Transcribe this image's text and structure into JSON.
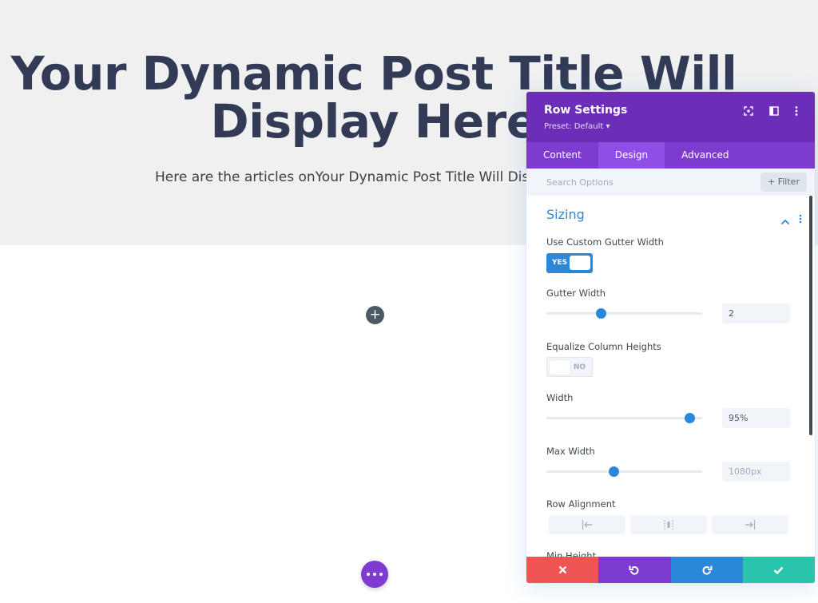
{
  "hero": {
    "title": "Your Dynamic Post Title Will Display Here",
    "subtitle": "Here are the articles onYour Dynamic Post Title Will Dis"
  },
  "canvas": {
    "add_icon": "+"
  },
  "panel": {
    "title": "Row Settings",
    "preset": "Preset: Default ▾",
    "tabs": [
      {
        "label": "Content"
      },
      {
        "label": "Design"
      },
      {
        "label": "Advanced"
      }
    ],
    "active_tab": "Design",
    "search": {
      "placeholder": "Search Options"
    },
    "filter_label": "+ Filter",
    "section": {
      "title": "Sizing",
      "use_custom_gutter": {
        "label": "Use Custom Gutter Width",
        "value": "YES"
      },
      "gutter_width": {
        "label": "Gutter Width",
        "value": "2",
        "slider_fraction": 0.35
      },
      "equalize_heights": {
        "label": "Equalize Column Heights",
        "value": "NO"
      },
      "width": {
        "label": "Width",
        "value": "95%",
        "slider_fraction": 0.92
      },
      "max_width": {
        "label": "Max Width",
        "placeholder": "1080px",
        "slider_fraction": 0.43
      },
      "row_alignment": {
        "label": "Row Alignment",
        "options": [
          "left",
          "center",
          "right"
        ]
      },
      "min_height": {
        "label": "Min Height"
      }
    },
    "footer": {
      "buttons": [
        "cancel",
        "undo",
        "redo",
        "save"
      ],
      "colors": {
        "cancel": "#ef5555",
        "undo": "#7e3bd0",
        "redo": "#2b87da",
        "save": "#29c4a9"
      }
    }
  },
  "colors": {
    "header_purple": "#6c2eb9",
    "tab_purple": "#7d3bcf",
    "accent_blue": "#2b87da",
    "hero_text": "#323a56"
  }
}
